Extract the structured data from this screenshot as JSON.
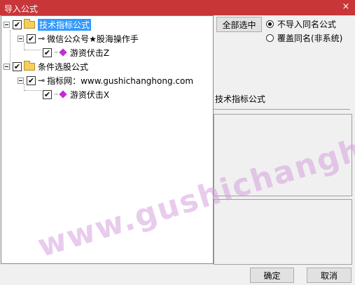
{
  "window": {
    "title": "导入公式",
    "close_glyph": "×"
  },
  "tree": {
    "items": [
      {
        "label": "技术指标公式",
        "checked": "✔"
      },
      {
        "label": "微信公众号★股海操作手",
        "checked": "✔"
      },
      {
        "label": "游资伏击Z",
        "checked": "✔"
      },
      {
        "label": "条件选股公式",
        "checked": "✔"
      },
      {
        "label": "指标网：www.gushichanghong.com",
        "checked": "✔"
      },
      {
        "label": "游资伏击X",
        "checked": "✔"
      }
    ]
  },
  "right_panel": {
    "select_all_label": "全部选中",
    "option_skip_label": "不导入同名公式",
    "option_overwrite_label": "覆盖同名(非系统)",
    "info_label": "技术指标公式"
  },
  "footer": {
    "ok_label": "确定",
    "cancel_label": "取消"
  },
  "watermark": "www.gushichanghong.com"
}
